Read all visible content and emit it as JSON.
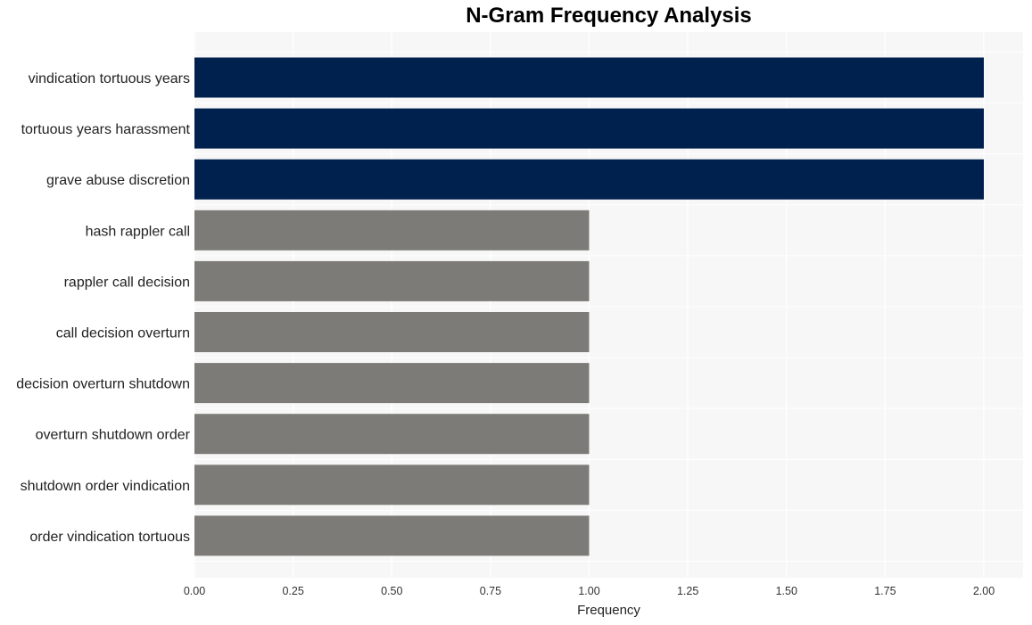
{
  "chart_data": {
    "type": "bar",
    "orientation": "horizontal",
    "title": "N-Gram Frequency Analysis",
    "xlabel": "Frequency",
    "ylabel": "",
    "xlim": [
      0,
      2.1
    ],
    "x_ticks": [
      "0.00",
      "0.25",
      "0.50",
      "0.75",
      "1.00",
      "1.25",
      "1.50",
      "1.75",
      "2.00"
    ],
    "x_tick_values": [
      0,
      0.25,
      0.5,
      0.75,
      1.0,
      1.25,
      1.5,
      1.75,
      2.0
    ],
    "grid": true,
    "categories": [
      "vindication tortuous years",
      "tortuous years harassment",
      "grave abuse discretion",
      "hash rappler call",
      "rappler call decision",
      "call decision overturn",
      "decision overturn shutdown",
      "overturn shutdown order",
      "shutdown order vindication",
      "order vindication tortuous"
    ],
    "values": [
      2,
      2,
      2,
      1,
      1,
      1,
      1,
      1,
      1,
      1
    ],
    "colors": {
      "highlight": "#00204e",
      "default": "#7c7b77",
      "plot_background": "#f7f7f7",
      "gridline": "#ffffff"
    }
  }
}
